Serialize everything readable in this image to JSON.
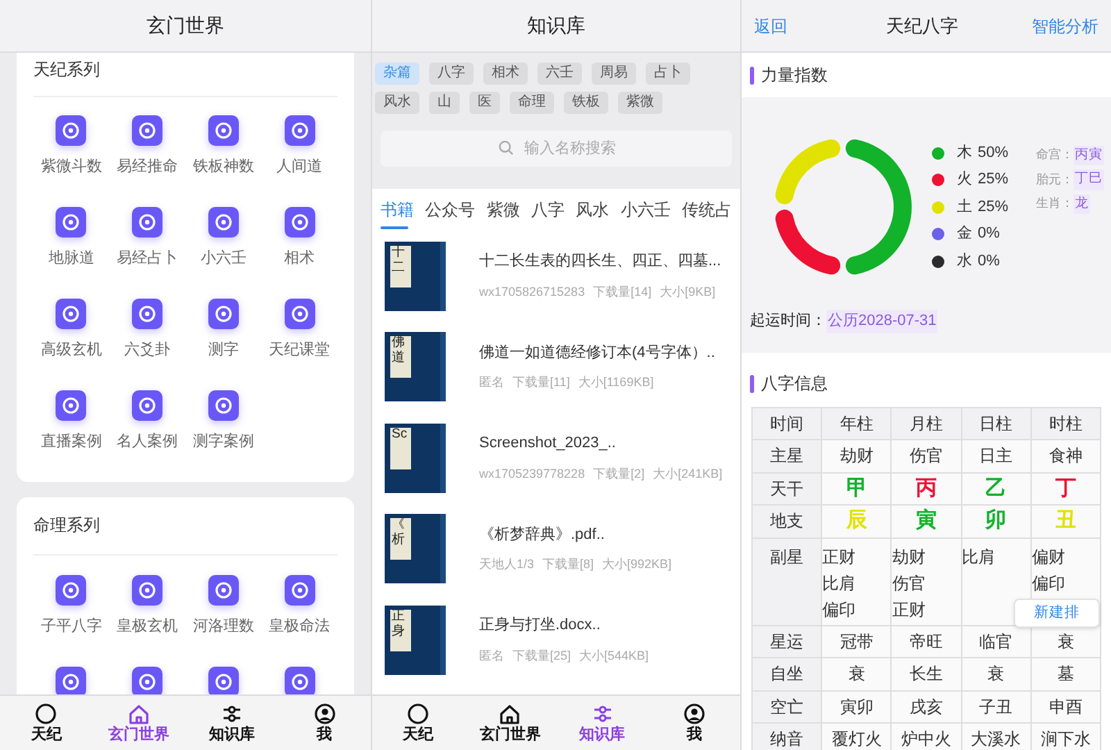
{
  "xuanmen": {
    "title": "玄门世界",
    "cards": [
      {
        "title": "天纪系列",
        "items": [
          {
            "kind": "tile",
            "label": "紫微斗数"
          },
          {
            "kind": "tile",
            "label": "易经推命"
          },
          {
            "kind": "tile",
            "label": "铁板神数"
          },
          {
            "kind": "tile",
            "label": "人间道"
          },
          {
            "kind": "tile",
            "label": "地脉道"
          },
          {
            "kind": "tile",
            "label": "易经占卜"
          },
          {
            "kind": "tile",
            "label": "小六壬"
          },
          {
            "kind": "tile",
            "label": "相术"
          },
          {
            "kind": "tile",
            "label": "高级玄机"
          },
          {
            "kind": "tile",
            "label": "六爻卦"
          },
          {
            "kind": "tile",
            "label": "测字"
          },
          {
            "kind": "tile",
            "label": "天纪课堂"
          },
          {
            "kind": "tile",
            "label": "直播案例"
          },
          {
            "kind": "tile",
            "label": "名人案例"
          },
          {
            "kind": "tile",
            "label": "测字案例"
          }
        ]
      },
      {
        "title": "命理系列",
        "items": [
          {
            "kind": "tile",
            "label": "子平八字"
          },
          {
            "kind": "tile",
            "label": "皇极玄机"
          },
          {
            "kind": "tile",
            "label": "河洛理数"
          },
          {
            "kind": "tile",
            "label": "皇极命法"
          },
          {
            "kind": "icon"
          },
          {
            "kind": "icon"
          },
          {
            "kind": "icon"
          },
          {
            "kind": "icon"
          }
        ]
      }
    ],
    "tab_bar": [
      {
        "label": "天纪",
        "selected": false
      },
      {
        "label": "玄门世界",
        "selected": true
      },
      {
        "label": "知识库",
        "selected": false
      },
      {
        "label": "我",
        "selected": false
      }
    ]
  },
  "knowledge": {
    "title": "知识库",
    "chips": [
      {
        "label": "杂篇",
        "selected": true
      },
      {
        "label": "八字",
        "selected": false
      },
      {
        "label": "相术",
        "selected": false
      },
      {
        "label": "六壬",
        "selected": false
      },
      {
        "label": "周易",
        "selected": false
      },
      {
        "label": "占卜",
        "selected": false
      },
      {
        "label": "风水",
        "selected": false
      },
      {
        "label": "山",
        "selected": false
      },
      {
        "label": "医",
        "selected": false
      },
      {
        "label": "命理",
        "selected": false
      },
      {
        "label": "铁板",
        "selected": false
      },
      {
        "label": "紫微",
        "selected": false
      }
    ],
    "search": {
      "placeholder": "输入名称搜索"
    },
    "tabs": [
      {
        "label": "书籍",
        "selected": true
      },
      {
        "label": "公众号",
        "selected": false
      },
      {
        "label": "紫微",
        "selected": false
      },
      {
        "label": "八字",
        "selected": false
      },
      {
        "label": "风水",
        "selected": false
      },
      {
        "label": "小六壬",
        "selected": false
      },
      {
        "label": "传统占",
        "selected": false
      }
    ],
    "books": [
      {
        "cover": "十二",
        "title": "十二长生表的四长生、四正、四墓...",
        "author": "wx1705826715283",
        "downloads": "下载量[14]",
        "size": "大小[9KB]"
      },
      {
        "cover": "佛道",
        "title": "佛道一如道德经修订本(4号字体）..",
        "author": "匿名",
        "downloads": "下载量[11]",
        "size": "大小[1169KB]"
      },
      {
        "cover": "Sc",
        "title": "Screenshot_2023_..",
        "author": "wx1705239778228",
        "downloads": "下载量[2]",
        "size": "大小[241KB]"
      },
      {
        "cover": "《析",
        "title": "《析梦辞典》.pdf..",
        "author": "天地人1/3",
        "downloads": "下载量[8]",
        "size": "大小[992KB]"
      },
      {
        "cover": "正身",
        "title": "正身与打坐.docx..",
        "author": "匿名",
        "downloads": "下载量[25]",
        "size": "大小[544KB]"
      }
    ],
    "tab_bar": [
      {
        "label": "天纪",
        "selected": false
      },
      {
        "label": "玄门世界",
        "selected": false
      },
      {
        "label": "知识库",
        "selected": true
      },
      {
        "label": "我",
        "selected": false
      }
    ]
  },
  "bazi": {
    "header": {
      "back": "返回",
      "title": "天纪八字",
      "action": "智能分析"
    },
    "strength": {
      "title": "力量指数",
      "chart_data": {
        "type": "donut",
        "categories": [
          "木",
          "火",
          "土",
          "金",
          "水"
        ],
        "values": [
          50,
          25,
          25,
          0,
          0
        ]
      },
      "legend": [
        {
          "value": "50%",
          "color": "#12b22a"
        },
        {
          "value": "25%",
          "color": "#ee1133"
        },
        {
          "value": "25%",
          "color": "#e2e201"
        },
        {
          "value": "0%",
          "color": "#6b62e8"
        },
        {
          "value": "0%",
          "color": "#2b2b2b"
        }
      ],
      "info": [
        {
          "label": "命宫：",
          "value": "丙寅"
        },
        {
          "label": "胎元：",
          "value": "丁巳"
        },
        {
          "label": "生肖：",
          "value": "龙"
        }
      ],
      "start_luck": {
        "label": "起运时间：",
        "value": "公历2028-07-31"
      }
    },
    "table": {
      "title": "八字信息",
      "corner": "时间",
      "columns": [
        "年柱",
        "月柱",
        "日柱",
        "时柱"
      ],
      "rows": [
        {
          "kind": "text",
          "label": "主星",
          "cells": [
            "劫财",
            "伤官",
            "日主",
            "食神"
          ]
        },
        {
          "kind": "element",
          "label": "天干",
          "cells": [
            {
              "text": "甲",
              "color": "#12b22a"
            },
            {
              "text": "丙",
              "color": "#ee1133"
            },
            {
              "text": "乙",
              "color": "#12b22a"
            },
            {
              "text": "丁",
              "color": "#ee1133"
            }
          ]
        },
        {
          "kind": "element",
          "label": "地支",
          "cells": [
            {
              "text": "辰",
              "color": "#e2e201"
            },
            {
              "text": "寅",
              "color": "#12b22a"
            },
            {
              "text": "卯",
              "color": "#12b22a"
            },
            {
              "text": "丑",
              "color": "#e2e201"
            }
          ]
        },
        {
          "kind": "multi",
          "label": "副星",
          "cells": [
            [
              "正财",
              "比肩",
              "偏印"
            ],
            [
              "劫财",
              "伤官",
              "正财"
            ],
            [
              "比肩"
            ],
            [
              "偏财",
              "偏印"
            ]
          ]
        },
        {
          "kind": "text",
          "label": "星运",
          "cells": [
            "冠带",
            "帝旺",
            "临官",
            "衰"
          ]
        },
        {
          "kind": "text",
          "label": "自坐",
          "cells": [
            "衰",
            "长生",
            "衰",
            "墓"
          ]
        },
        {
          "kind": "text",
          "label": "空亡",
          "cells": [
            "寅卯",
            "戌亥",
            "子丑",
            "申酉"
          ]
        },
        {
          "kind": "text",
          "label": "纳音",
          "cells": [
            "覆灯火",
            "炉中火",
            "大溪水",
            "涧下水"
          ]
        }
      ]
    },
    "popup_button": "新建排"
  }
}
